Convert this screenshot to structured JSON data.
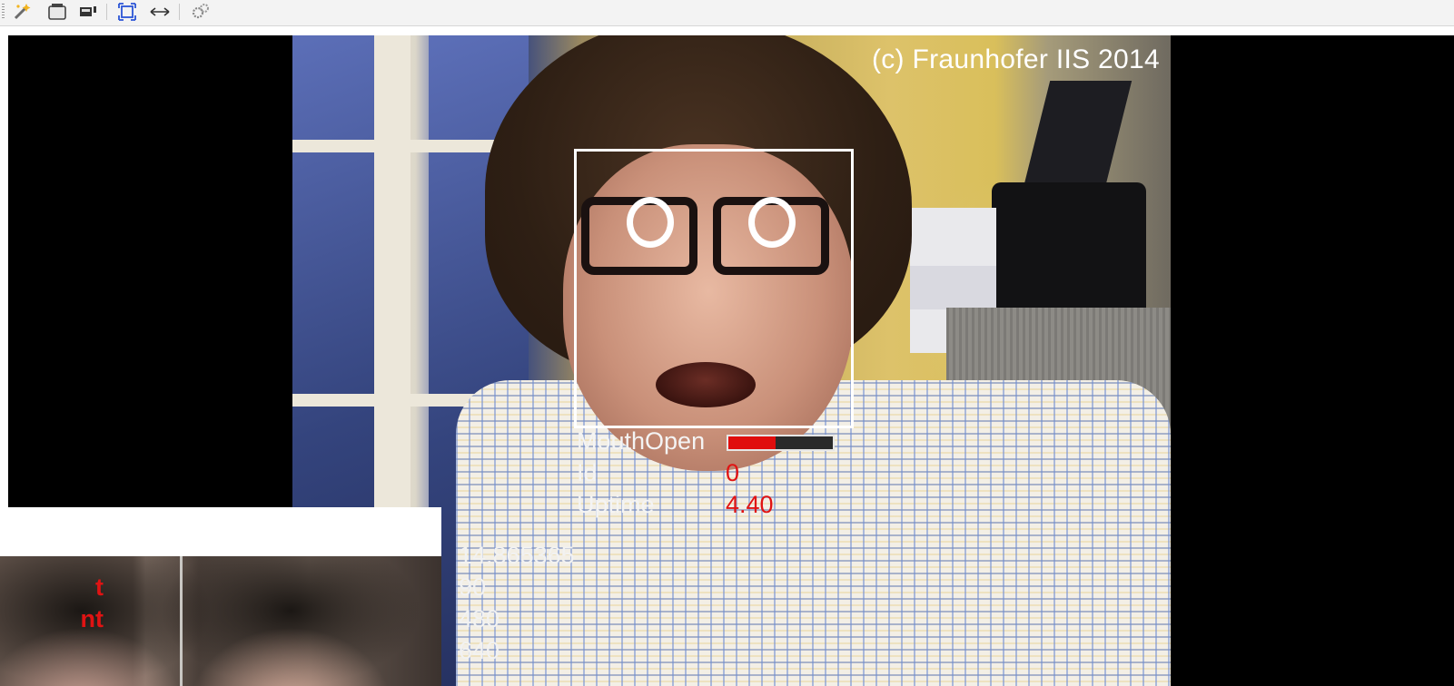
{
  "toolbar": {
    "buttons": [
      {
        "icon": "wizard-icon"
      },
      {
        "icon": "camera-icon"
      },
      {
        "icon": "video-source-icon"
      },
      {
        "icon": "fit-to-window-icon"
      },
      {
        "icon": "stretch-horizontal-icon"
      },
      {
        "icon": "settings-gears-icon"
      }
    ]
  },
  "video": {
    "copyright": "(c) Fraunhofer IIS 2014",
    "eye_markers": [
      "O",
      "O"
    ],
    "face": {
      "labels": {
        "mouth_open": "MouthOpen",
        "id": "Id",
        "uptime": "Uptime"
      },
      "mouth_open_level": 0.45,
      "id": "0",
      "uptime": "4.40"
    },
    "colors": {
      "value_text": "#e01313",
      "meter_fill": "#e00d0d",
      "box": "#ffffff"
    }
  },
  "stats": [
    {
      "label": "",
      "value": "14.865365"
    },
    {
      "label": "t",
      "value": "90"
    },
    {
      "label": "nt",
      "value": "480"
    },
    {
      "label": "",
      "value": "640"
    }
  ]
}
